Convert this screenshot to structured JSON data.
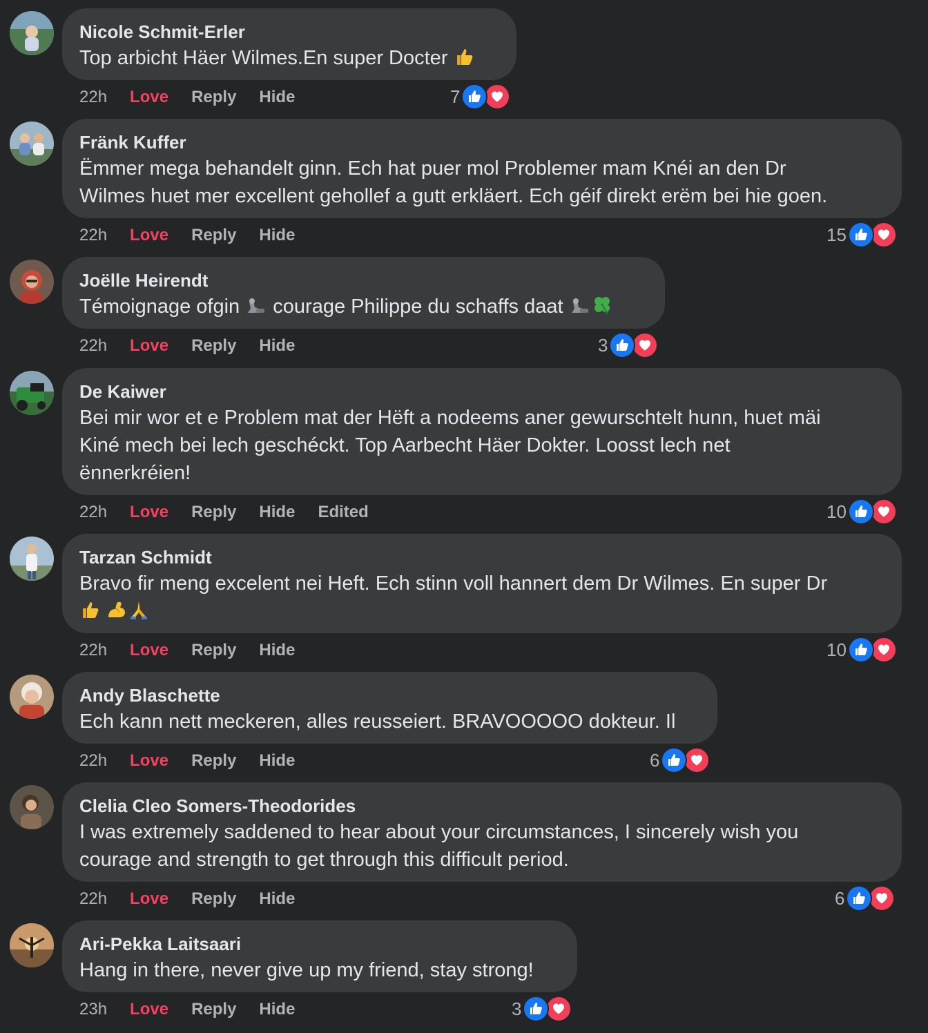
{
  "colors": {
    "background": "#242526",
    "bubble": "#3a3b3c",
    "love": "#f3425f",
    "like_blue": "#1877f2",
    "heart_red": "#f33e58",
    "meta_gray": "#b0b3b8"
  },
  "actions": {
    "love": "Love",
    "reply": "Reply",
    "hide": "Hide",
    "edited": "Edited"
  },
  "comments": [
    {
      "author": "Nicole Schmit-Erler",
      "lines": [
        "Top arbicht Häer Wilmes.En super Docter"
      ],
      "emoji": [
        "thumbs-up"
      ],
      "time": "22h",
      "edited": false,
      "reaction_count": "7",
      "reactions": [
        "like",
        "love"
      ]
    },
    {
      "author": "Fränk Kuffer",
      "lines": [
        "Ëmmer mega behandelt ginn. Ech hat puer mol Problemer mam Knéi an den Dr",
        "Wilmes huet mer excellent gehollef a gutt erkläert. Ech géif direkt erëm bei hie goen."
      ],
      "time": "22h",
      "edited": false,
      "reaction_count": "15",
      "reactions": [
        "like",
        "love"
      ]
    },
    {
      "author": "Joëlle Heirendt",
      "lines": [
        "Témoignage ofgin",
        "courage Philippe du schaffs daat"
      ],
      "emoji": [
        "mechanical-arm",
        "mechanical-arm",
        "four-leaf-clover"
      ],
      "time": "22h",
      "edited": false,
      "reaction_count": "3",
      "reactions": [
        "like",
        "love"
      ]
    },
    {
      "author": "De Kaiwer",
      "lines": [
        "Bei mir wor et e Problem mat der Hëft a nodeems aner gewurschtelt hunn, huet mäi",
        "Kiné mech bei lech geschéckt. Top Aarbecht Häer Dokter. Loosst lech net",
        "ënnerkréien!"
      ],
      "time": "22h",
      "edited": true,
      "reaction_count": "10",
      "reactions": [
        "like",
        "love"
      ]
    },
    {
      "author": "Tarzan Schmidt",
      "lines": [
        "Bravo fir meng excelent nei Heft. Ech stinn voll hannert dem Dr Wilmes. En super Dr"
      ],
      "emoji": [
        "thumbs-up",
        "flexed-biceps",
        "folded-hands"
      ],
      "time": "22h",
      "edited": false,
      "reaction_count": "10",
      "reactions": [
        "like",
        "love"
      ]
    },
    {
      "author": "Andy Blaschette",
      "lines": [
        "Ech kann nett meckeren, alles reusseiert. BRAVOOOOO dokteur. Il"
      ],
      "time": "22h",
      "edited": false,
      "reaction_count": "6",
      "reactions": [
        "like",
        "love"
      ]
    },
    {
      "author": "Clelia Cleo Somers-Theodorides",
      "lines": [
        "I was extremely saddened to hear about your circumstances, I sincerely wish you",
        "courage and strength to get through this difficult period."
      ],
      "time": "22h",
      "edited": false,
      "reaction_count": "6",
      "reactions": [
        "like",
        "love"
      ]
    },
    {
      "author": "Ari-Pekka Laitsaari",
      "lines": [
        "Hang in there, never give up my friend, stay strong!"
      ],
      "time": "23h",
      "edited": false,
      "reaction_count": "3",
      "reactions": [
        "like",
        "love"
      ]
    }
  ]
}
